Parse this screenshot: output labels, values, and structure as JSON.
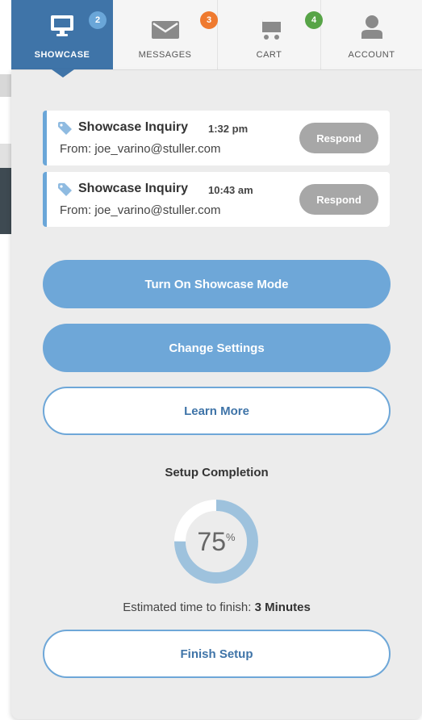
{
  "nav": {
    "tabs": [
      {
        "label": "SHOWCASE",
        "icon": "monitor-icon",
        "badge": "2",
        "active": true
      },
      {
        "label": "MESSAGES",
        "icon": "envelope-icon",
        "badge": "3"
      },
      {
        "label": "CART",
        "icon": "cart-icon",
        "badge": "4"
      },
      {
        "label": "ACCOUNT",
        "icon": "user-icon"
      }
    ]
  },
  "inquiries": [
    {
      "title": "Showcase Inquiry",
      "time": "1:32 pm",
      "from": "From: joe_varino@stuller.com",
      "action": "Respond"
    },
    {
      "title": "Showcase Inquiry",
      "time": "10:43 am",
      "from": "From: joe_varino@stuller.com",
      "action": "Respond"
    }
  ],
  "buttons": {
    "showcase_mode": "Turn On Showcase Mode",
    "change_settings": "Change Settings",
    "learn_more": "Learn More",
    "finish_setup": "Finish Setup"
  },
  "setup": {
    "title": "Setup Completion",
    "percent": 75,
    "percent_label": "75",
    "percent_sign": "%",
    "estimate_label": "Estimated time to finish:",
    "estimate_value": "3 Minutes"
  },
  "colors": {
    "accent": "#3f74a8",
    "button_blue": "#6ea7d8",
    "respond_gray": "#a7a7a7",
    "badge_blue": "#6aa6d8",
    "badge_orange": "#ef7a2f",
    "badge_green": "#57a447"
  }
}
